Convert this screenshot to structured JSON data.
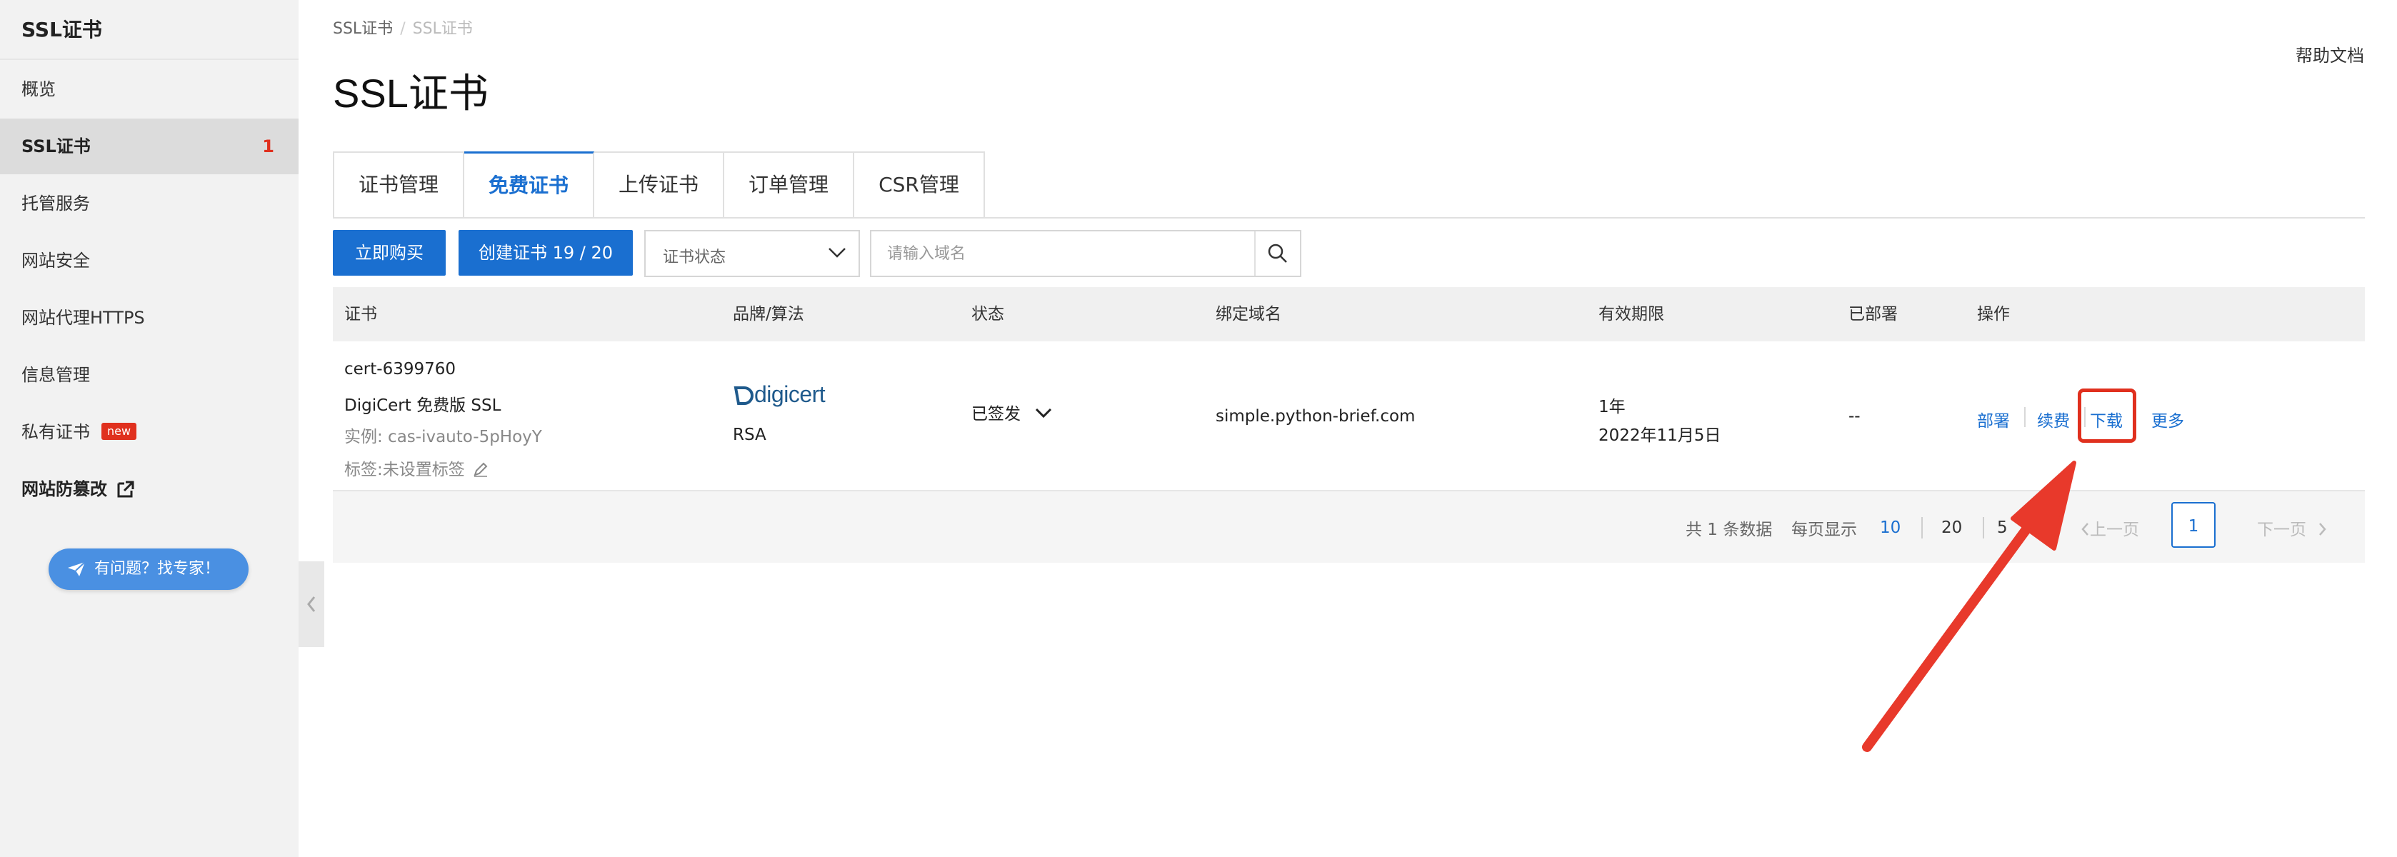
{
  "sidebar": {
    "title": "SSL证书",
    "items": [
      {
        "label": "概览"
      },
      {
        "label": "SSL证书",
        "count": "1"
      },
      {
        "label": "托管服务"
      },
      {
        "label": "网站安全"
      },
      {
        "label": "网站代理HTTPS"
      },
      {
        "label": "信息管理"
      },
      {
        "label": "私有证书",
        "badge": "new"
      },
      {
        "label": "网站防篡改"
      }
    ],
    "expert_button": "有问题？找专家！"
  },
  "breadcrumb": {
    "root": "SSL证书",
    "separator": "/",
    "current": "SSL证书"
  },
  "page_title": "SSL证书",
  "help_link": "帮助文档",
  "tabs": [
    {
      "label": "证书管理"
    },
    {
      "label": "免费证书"
    },
    {
      "label": "上传证书"
    },
    {
      "label": "订单管理"
    },
    {
      "label": "CSR管理"
    }
  ],
  "toolbar": {
    "buy_button": "立即购买",
    "create_button": "创建证书 19 / 20",
    "status_select_placeholder": "证书状态",
    "search_placeholder": "请输入域名"
  },
  "table": {
    "headers": [
      "证书",
      "品牌/算法",
      "状态",
      "绑定域名",
      "有效期限",
      "已部署",
      "操作"
    ],
    "rows": [
      {
        "cert_id": "cert-6399760",
        "cert_name": "DigiCert 免费版 SSL",
        "instance": "实例: cas-ivauto-5pHoyY",
        "tags": "标签:未设置标签",
        "brand": "digicert",
        "algorithm": "RSA",
        "status": "已签发",
        "domain": "simple.python-brief.com",
        "validity_period": "1年",
        "validity_date": "2022年11月5日",
        "deployed": "--",
        "actions": {
          "deploy": "部署",
          "renew": "续费",
          "download": "下载",
          "more": "更多"
        }
      }
    ]
  },
  "pagination": {
    "total": "共 1 条数据",
    "per_page_label": "每页显示",
    "sizes": [
      "10",
      "20",
      "5"
    ],
    "prev": "上一页",
    "current_page": "1",
    "next": "下一页"
  },
  "colors": {
    "accent": "#1a6fd0",
    "highlight": "#e0301e",
    "sidebar_bg": "#f2f2f2"
  }
}
